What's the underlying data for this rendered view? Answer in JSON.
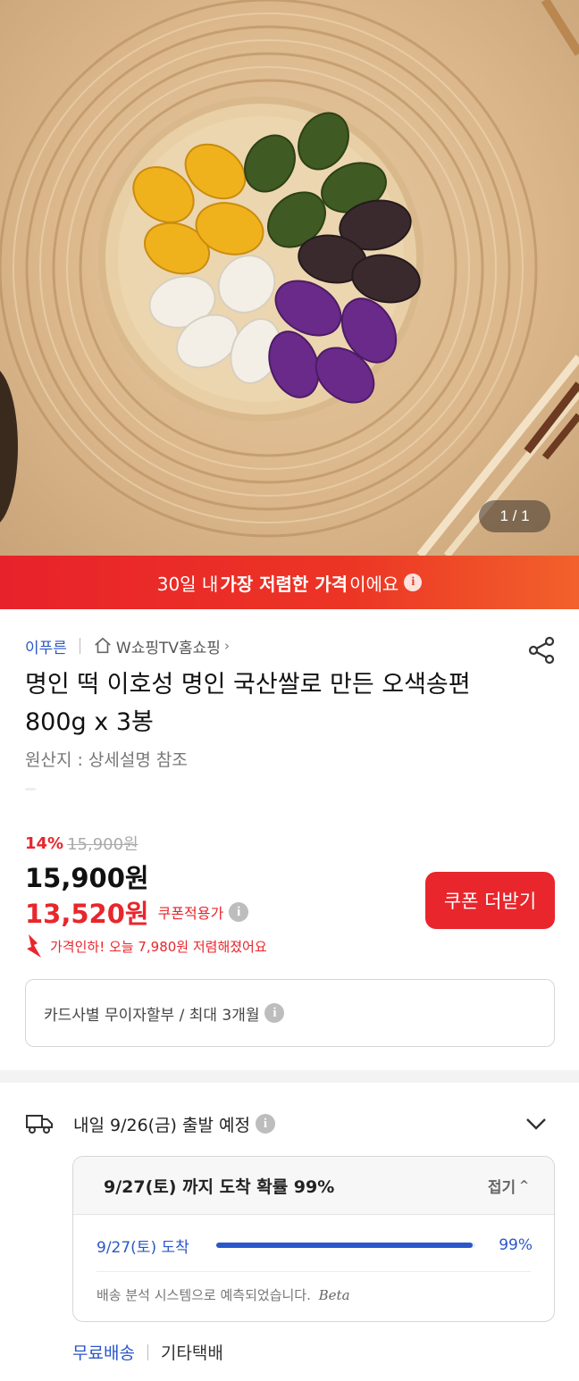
{
  "gallery": {
    "counter": "1 / 1"
  },
  "banner": {
    "prefix": "30일 내 ",
    "highlight": "가장 저렴한 가격",
    "suffix": "이에요",
    "info_icon": "info-icon"
  },
  "seller": {
    "name": "이푸른",
    "shop": "W쇼핑TV홈쇼핑",
    "shop_chevron": "›"
  },
  "product": {
    "title": "명인 떡 이호성 명인 국산쌀로 만든 오색송편 800g x 3봉",
    "origin": "원산지 : 상세설명 참조"
  },
  "price": {
    "discount_rate": "14%",
    "original": "15,900원",
    "current": "15,900원",
    "coupon_price": "13,520원",
    "coupon_label": "쿠폰적용가",
    "drop_notice": "가격인하! 오늘 7,980원 저렴해졌어요"
  },
  "coupon_button": {
    "label": "쿠폰 더받기"
  },
  "installment": {
    "text": "카드사별 무이자할부 / 최대 3개월"
  },
  "shipping": {
    "departure": "내일 9/26(금) 출발 예정",
    "arrival_headline": "9/27(토) 까지 도착 확률 99%",
    "collapse_label": "접기",
    "arrival_date": "9/27(토) 도착",
    "arrival_probability": "99%",
    "arrival_probability_value": 0.99,
    "note": "배송 분석 시스템으로 예측되었습니다.",
    "beta": "Beta",
    "free_shipping": "무료배송",
    "carrier": "기타택배"
  },
  "colors": {
    "accent_red": "#e8262c",
    "accent_blue": "#2a57c9"
  }
}
